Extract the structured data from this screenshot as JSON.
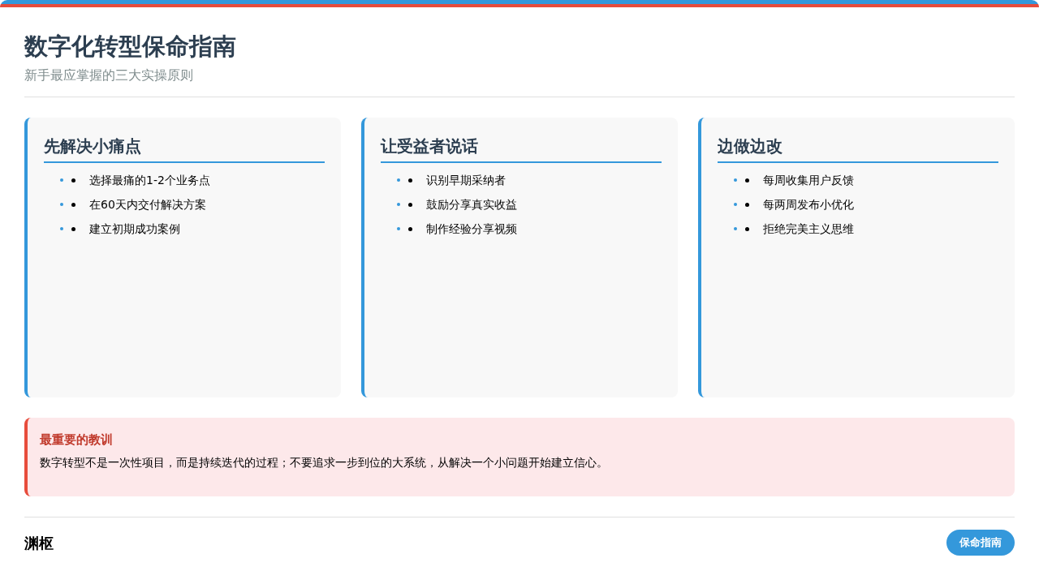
{
  "header": {
    "title": "数字化转型保命指南",
    "subtitle": "新手最应掌握的三大实操原则"
  },
  "cards": [
    {
      "title": "先解决小痛点",
      "items": [
        "选择最痛的1-2个业务点",
        "在60天内交付解决方案",
        "建立初期成功案例"
      ]
    },
    {
      "title": "让受益者说话",
      "items": [
        "识别早期采纳者",
        "鼓励分享真实收益",
        "制作经验分享视频"
      ]
    },
    {
      "title": "边做边改",
      "items": [
        "每周收集用户反馈",
        "每两周发布小优化",
        "拒绝完美主义思维"
      ]
    }
  ],
  "lesson": {
    "title": "最重要的教训",
    "text": "数字转型不是一次性项目，而是持续迭代的过程；不要追求一步到位的大系统，从解决一个小问题开始建立信心。"
  },
  "footer": {
    "brand": "渊枢",
    "tag": "保命指南"
  }
}
